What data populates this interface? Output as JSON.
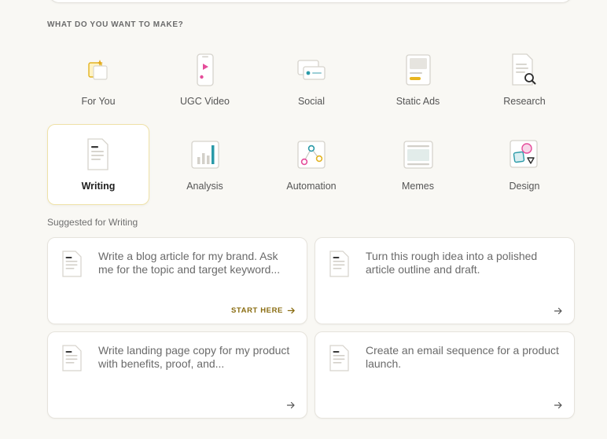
{
  "section_heading": "WHAT DO YOU WANT TO MAKE?",
  "categories": [
    {
      "label": "For You",
      "icon": "sparkle-cards-icon"
    },
    {
      "label": "UGC Video",
      "icon": "phone-video-icon"
    },
    {
      "label": "Social",
      "icon": "social-post-icon"
    },
    {
      "label": "Static Ads",
      "icon": "static-ad-icon"
    },
    {
      "label": "Research",
      "icon": "document-search-icon"
    },
    {
      "label": "Writing",
      "icon": "document-icon",
      "selected": true
    },
    {
      "label": "Analysis",
      "icon": "bar-chart-icon"
    },
    {
      "label": "Automation",
      "icon": "workflow-nodes-icon"
    },
    {
      "label": "Memes",
      "icon": "meme-frame-icon"
    },
    {
      "label": "Design",
      "icon": "shapes-icon"
    }
  ],
  "suggested_heading": "Suggested for Writing",
  "suggestions": [
    {
      "text": "Write a blog article for my brand. Ask me for the topic and target keyword...",
      "cta": "START HERE"
    },
    {
      "text": "Turn this rough idea into a polished article outline and draft."
    },
    {
      "text": "Write landing page copy for my product with benefits, proof, and..."
    },
    {
      "text": "Create an email sequence for a product launch."
    }
  ],
  "colors": {
    "background": "#f9f8f4",
    "accent_gold": "#8a6d12",
    "selected_border": "#efe2a8"
  }
}
